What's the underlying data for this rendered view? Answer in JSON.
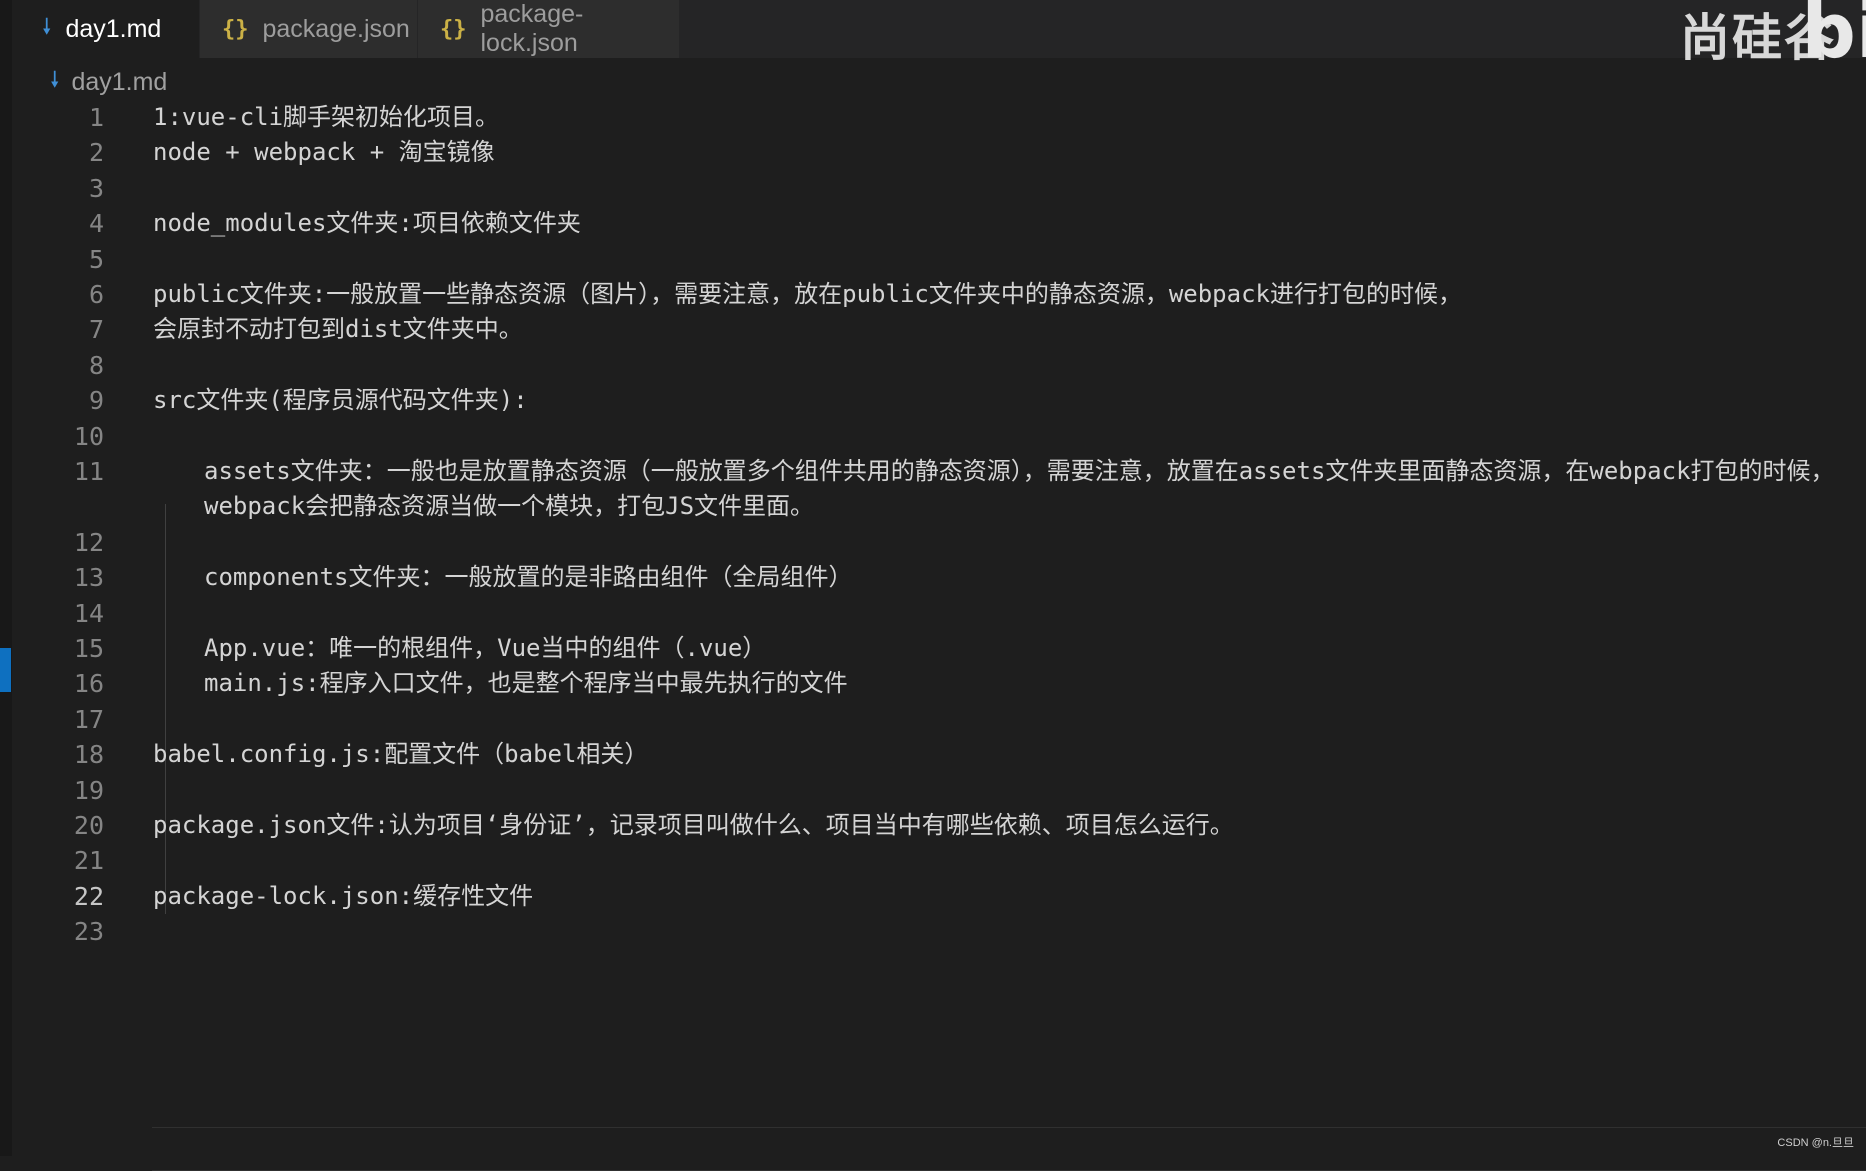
{
  "tabs": [
    {
      "label": "day1.md",
      "icon": "markdown-icon",
      "active": true,
      "close": "✕"
    },
    {
      "label": "package.json",
      "icon": "json-icon",
      "active": false
    },
    {
      "label": "package-lock.json",
      "icon": "json-icon",
      "active": false
    }
  ],
  "icons": {
    "json": "{}",
    "markdown": "🠗"
  },
  "watermark": {
    "text": "尚硅谷",
    "b": "bi"
  },
  "breadcrumb": {
    "file": "day1.md"
  },
  "editor": {
    "current_line": 22,
    "lines": [
      {
        "n": "1",
        "text": "1:vue-cli脚手架初始化项目。"
      },
      {
        "n": "2",
        "text": "node + webpack + 淘宝镜像"
      },
      {
        "n": "3",
        "text": ""
      },
      {
        "n": "4",
        "text": "node_modules文件夹:项目依赖文件夹"
      },
      {
        "n": "5",
        "text": ""
      },
      {
        "n": "6",
        "text": "public文件夹:一般放置一些静态资源（图片），需要注意，放在public文件夹中的静态资源，webpack进行打包的时候，"
      },
      {
        "n": "7",
        "text": "会原封不动打包到dist文件夹中。"
      },
      {
        "n": "8",
        "text": ""
      },
      {
        "n": "9",
        "text": "src文件夹(程序员源代码文件夹):"
      },
      {
        "n": "10",
        "text": ""
      },
      {
        "n": "11",
        "text": "assets文件夹：一般也是放置静态资源（一般放置多个组件共用的静态资源），需要注意，放置在assets文件夹里面静态资源，在webpack打包的时候，webpack会把静态资源当做一个模块，打包JS文件里面。"
      },
      {
        "n": "12",
        "text": ""
      },
      {
        "n": "13",
        "text": "components文件夹：一般放置的是非路由组件（全局组件）"
      },
      {
        "n": "14",
        "text": ""
      },
      {
        "n": "15",
        "text": "App.vue：唯一的根组件，Vue当中的组件（.vue）"
      },
      {
        "n": "16",
        "text": "main.js:程序入口文件，也是整个程序当中最先执行的文件"
      },
      {
        "n": "17",
        "text": ""
      },
      {
        "n": "18",
        "text": "babel.config.js:配置文件（babel相关）"
      },
      {
        "n": "19",
        "text": ""
      },
      {
        "n": "20",
        "text": "package.json文件:认为项目‘身份证’，记录项目叫做什么、项目当中有哪些依赖、项目怎么运行。"
      },
      {
        "n": "21",
        "text": ""
      },
      {
        "n": "22",
        "text": "package-lock.json:缓存性文件"
      },
      {
        "n": "23",
        "text": ""
      }
    ]
  },
  "footer": {
    "csdn": "CSDN @n.旦旦"
  }
}
